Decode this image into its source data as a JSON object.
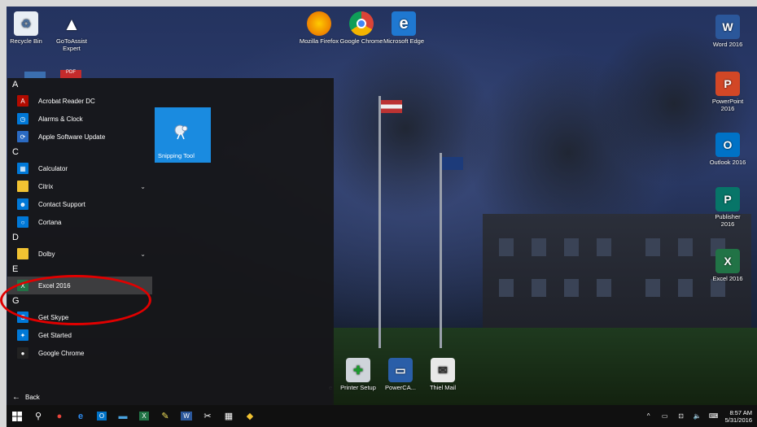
{
  "desktop_icons": {
    "recycle_bin": "Recycle Bin",
    "gotoassist": "GoToAssist Expert",
    "firefox": "Mozilla Firefox",
    "chrome": "Google Chrome",
    "edge": "Microsoft Edge",
    "word": "Word 2016",
    "powerpoint": "PowerPoint 2016",
    "outlook": "Outlook 2016",
    "publisher": "Publisher 2016",
    "excel": "Excel 2016",
    "printer_setup": "Printer Setup",
    "powerca": "PowerCA...",
    "thiel_mail": "Thiel Mail",
    "partial_label": "e"
  },
  "start_menu": {
    "sections": [
      {
        "letter": "A",
        "apps": [
          {
            "label": "Acrobat Reader DC",
            "icon": "acrobat-icon",
            "color": "#b30b00",
            "glyph": "A"
          },
          {
            "label": "Alarms & Clock",
            "icon": "clock-icon",
            "color": "#0078d7",
            "glyph": "◷"
          },
          {
            "label": "Apple Software Update",
            "icon": "apple-update-icon",
            "color": "#2a6ac2",
            "glyph": "⟳"
          }
        ]
      },
      {
        "letter": "C",
        "apps": [
          {
            "label": "Calculator",
            "icon": "calculator-icon",
            "color": "#0078d7",
            "glyph": "▦"
          },
          {
            "label": "Citrix",
            "icon": "folder-icon",
            "color": "#f1c232",
            "glyph": "",
            "chevron": true
          },
          {
            "label": "Contact Support",
            "icon": "contact-support-icon",
            "color": "#0078d7",
            "glyph": "☻"
          },
          {
            "label": "Cortana",
            "icon": "cortana-icon",
            "color": "#0078d7",
            "glyph": "○"
          }
        ]
      },
      {
        "letter": "D",
        "apps": [
          {
            "label": "Dolby",
            "icon": "folder-icon",
            "color": "#f1c232",
            "glyph": "",
            "chevron": true
          }
        ]
      },
      {
        "letter": "E",
        "apps": [
          {
            "label": "Excel 2016",
            "icon": "excel-icon",
            "color": "#217346",
            "glyph": "X",
            "highlight": true
          }
        ]
      },
      {
        "letter": "G",
        "apps": [
          {
            "label": "Get Skype",
            "icon": "skype-icon",
            "color": "#0078d7",
            "glyph": "S"
          },
          {
            "label": "Get Started",
            "icon": "lightbulb-icon",
            "color": "#0078d7",
            "glyph": "✦"
          },
          {
            "label": "Google Chrome",
            "icon": "chrome-icon",
            "color": "#222",
            "glyph": "●"
          }
        ]
      }
    ],
    "back_label": "Back",
    "tile_label": "Snipping Tool"
  },
  "taskbar": {
    "clock_time": "8:57 AM",
    "clock_date": "5/31/2016"
  },
  "colors": {
    "highlight_circle": "#e00000",
    "tile_blue": "#1a8be0"
  }
}
